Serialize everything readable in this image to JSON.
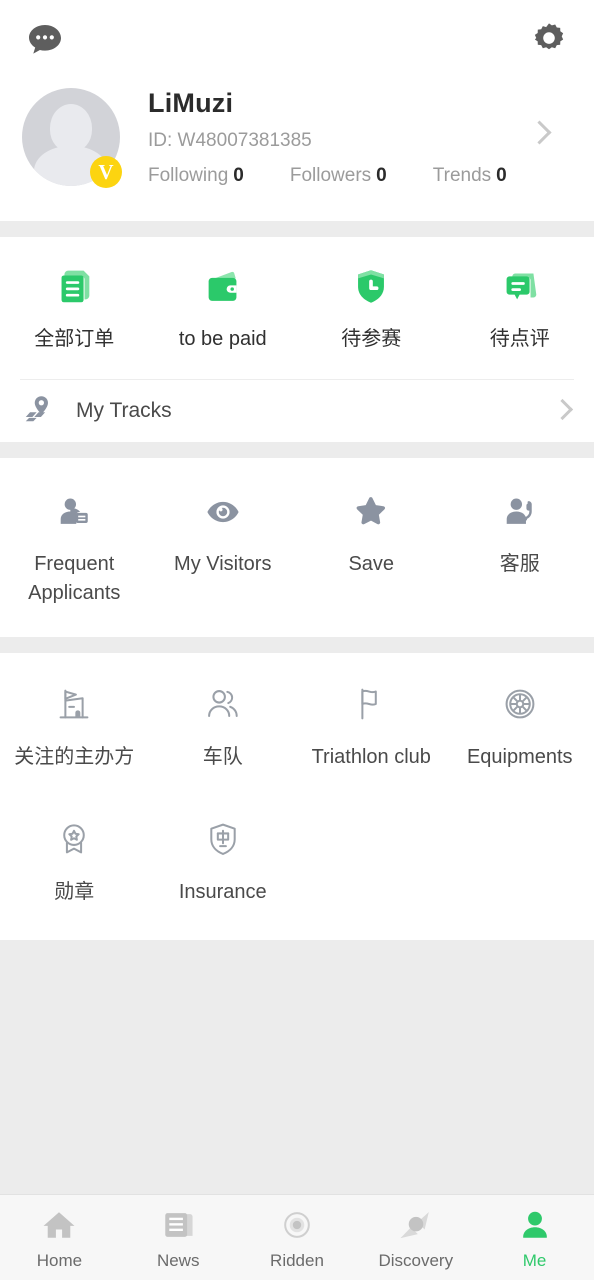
{
  "header": {
    "message_icon": "chat-bubble-dots-icon",
    "settings_icon": "gear-icon"
  },
  "profile": {
    "name": "LiMuzi",
    "id_label": "ID: W48007381385",
    "verified_badge": "V",
    "stats": [
      {
        "label": "Following",
        "value": "0"
      },
      {
        "label": "Followers",
        "value": "0"
      },
      {
        "label": "Trends",
        "value": "0"
      }
    ]
  },
  "orders": {
    "items": [
      {
        "label": "全部订单",
        "icon": "document-list-icon"
      },
      {
        "label": "to be paid",
        "icon": "wallet-icon"
      },
      {
        "label": "待参赛",
        "icon": "shield-clock-icon"
      },
      {
        "label": "待点评",
        "icon": "comment-bubble-icon"
      }
    ]
  },
  "tracks": {
    "label": "My Tracks",
    "icon": "location-track-icon"
  },
  "services": {
    "items": [
      {
        "label": "Frequent\nApplicants",
        "icon": "person-card-icon"
      },
      {
        "label": "My Visitors",
        "icon": "eye-icon"
      },
      {
        "label": "Save",
        "icon": "star-icon"
      },
      {
        "label": "客服",
        "icon": "person-headset-icon"
      }
    ]
  },
  "tools": {
    "row1": [
      {
        "label": "关注的主办方",
        "icon": "organizer-building-flag-icon"
      },
      {
        "label": "车队",
        "icon": "team-people-icon"
      },
      {
        "label": "Triathlon club",
        "icon": "flag-icon"
      },
      {
        "label": "Equipments",
        "icon": "wheel-icon"
      }
    ],
    "row2": [
      {
        "label": "勋章",
        "icon": "medal-badge-icon"
      },
      {
        "label": "Insurance",
        "icon": "insurance-shield-icon"
      }
    ]
  },
  "tabbar": {
    "items": [
      {
        "label": "Home",
        "icon": "home-icon",
        "active": false
      },
      {
        "label": "News",
        "icon": "news-icon",
        "active": false
      },
      {
        "label": "Ridden",
        "icon": "ridden-target-icon",
        "active": false
      },
      {
        "label": "Discovery",
        "icon": "discovery-compass-icon",
        "active": false
      },
      {
        "label": "Me",
        "icon": "person-icon",
        "active": true
      }
    ]
  },
  "colors": {
    "accent_green": "#2fc96b",
    "badge_yellow": "#fcd410",
    "page_bg": "#ececec",
    "icon_grey": "#8b93a1",
    "outline_grey": "#9aa0a8"
  }
}
